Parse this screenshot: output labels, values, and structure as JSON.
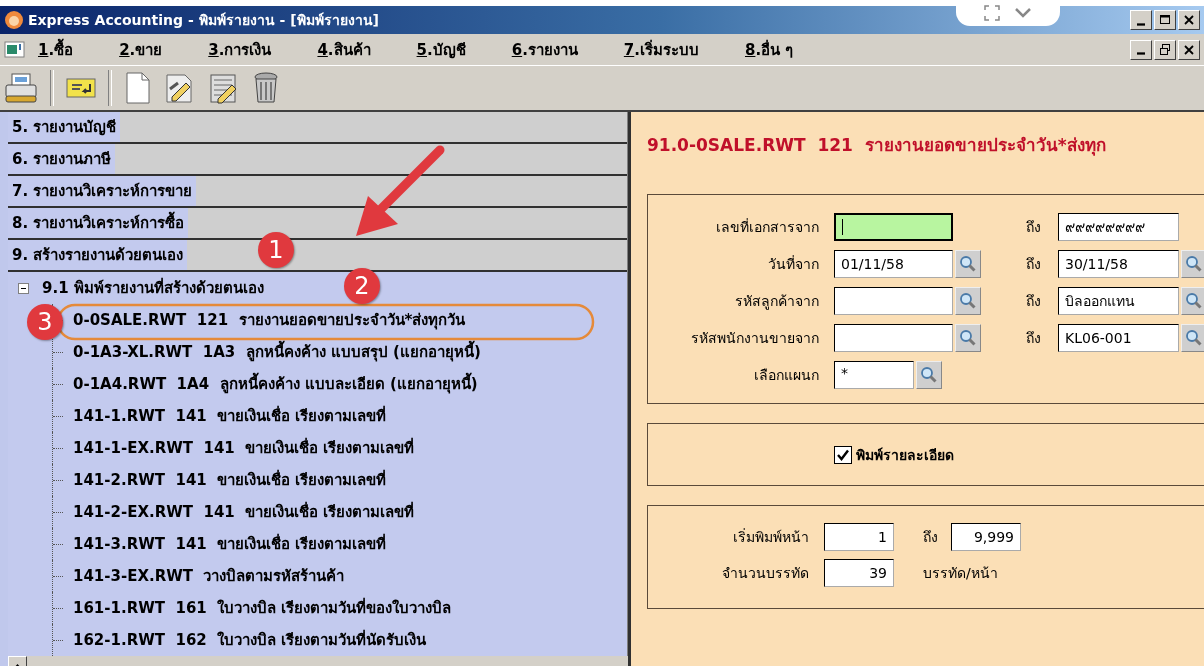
{
  "window": {
    "title": "Express Accounting - พิมพ์รายงาน - [พิมพ์รายงาน]"
  },
  "menu": [
    {
      "label": "1.ซื้อ"
    },
    {
      "label": "2.ขาย"
    },
    {
      "label": "3.การเงิน"
    },
    {
      "label": "4.สินค้า"
    },
    {
      "label": "5.บัญชี"
    },
    {
      "label": "6.รายงาน"
    },
    {
      "label": "7.เริ่มระบบ"
    },
    {
      "label": "8.อื่น ๆ"
    }
  ],
  "toolbar": [
    {
      "kind": "printer"
    },
    {
      "kind": "card"
    },
    {
      "kind": "separator"
    },
    {
      "kind": "new"
    },
    {
      "kind": "edit"
    },
    {
      "kind": "form"
    },
    {
      "kind": "trash"
    }
  ],
  "report_tree": [
    {
      "label": "5. รายงานบัญชี"
    },
    {
      "label": "6. รายงานภาษี"
    },
    {
      "label": "7. รายงานวิเคราะห์การขาย"
    },
    {
      "label": "8. รายงานวิเคราะห์การซื้อ"
    },
    {
      "label": "9. สร้างรายงานด้วยตนเอง",
      "children": [
        {
          "label": "9.1 พิมพ์รายงานที่สร้างด้วยตนเอง",
          "expanded": true,
          "children": [
            {
              "label": "0-0SALE.RWT  121  รายงานยอดขายประจำวัน*ส่งทุกวัน"
            },
            {
              "label": "0-1A3-XL.RWT  1A3  ลูกหนี้คงค้าง แบบสรุป (แยกอายุหนี้)"
            },
            {
              "label": "0-1A4.RWT  1A4  ลูกหนี้คงค้าง แบบละเอียด (แยกอายุหนี้)"
            },
            {
              "label": "141-1.RWT  141  ขายเงินเชื่อ เรียงตามเลขที่"
            },
            {
              "label": "141-1-EX.RWT  141  ขายเงินเชื่อ เรียงตามเลขที่"
            },
            {
              "label": "141-2.RWT  141  ขายเงินเชื่อ เรียงตามเลขที่"
            },
            {
              "label": "141-2-EX.RWT  141  ขายเงินเชื่อ เรียงตามเลขที่"
            },
            {
              "label": "141-3.RWT  141  ขายเงินเชื่อ เรียงตามเลขที่"
            },
            {
              "label": "141-3-EX.RWT  วางบิลตามรหัสร้านค้า"
            },
            {
              "label": "161-1.RWT  161  ใบวางบิล เรียงตามวันที่ของใบวางบิล"
            },
            {
              "label": "162-1.RWT  162  ใบวางบิล เรียงตามวันที่นัดรับเงิน"
            }
          ]
        }
      ]
    }
  ],
  "report_form": {
    "title": "91.0-0SALE.RWT  121  รายงานยอดขายประจำวัน*ส่งทุก",
    "range_fields": [
      {
        "label": "เลขที่เอกสารจาก",
        "from": {
          "focused": true,
          "lookup": false
        },
        "to_label": "ถึง",
        "to": {
          "value": "๙๙๙๙๙๙๙๙",
          "lookup": false
        }
      },
      {
        "label": "วันที่จาก",
        "from": {
          "value": "01/11/58",
          "focused": false,
          "lookup": true
        },
        "to_label": "ถึง",
        "to": {
          "value": "30/11/58",
          "lookup": true
        }
      },
      {
        "label": "รหัสลูกค้าจาก",
        "from": {
          "focused": false,
          "lookup": true
        },
        "to_label": "ถึง",
        "to": {
          "value": "บิลออกแทน",
          "lookup": true
        }
      },
      {
        "label": "รหัสพนักงานขายจาก",
        "from": {
          "focused": false,
          "lookup": true
        },
        "to_label": "ถึง",
        "to": {
          "value": "KL06-001",
          "lookup": true
        }
      }
    ],
    "department": {
      "label": "เลือกแผนก",
      "value": "*",
      "lookup": true
    },
    "print_detail": {
      "label": "พิมพ์รายละเอียด",
      "checked": true
    },
    "pages": {
      "start_label": "เริ่มพิมพ์หน้า",
      "start": "1",
      "to_label": "ถึง",
      "end": "9,999"
    },
    "lines": {
      "label": "จำนวนบรรทัด",
      "value": "39",
      "unit": "บรรทัด/หน้า"
    }
  },
  "annotations": [
    {
      "kind": "arrow"
    },
    {
      "kind": "number",
      "label": "1"
    },
    {
      "kind": "number",
      "label": "2"
    },
    {
      "kind": "number",
      "label": "3"
    },
    {
      "kind": "ellipse"
    }
  ]
}
